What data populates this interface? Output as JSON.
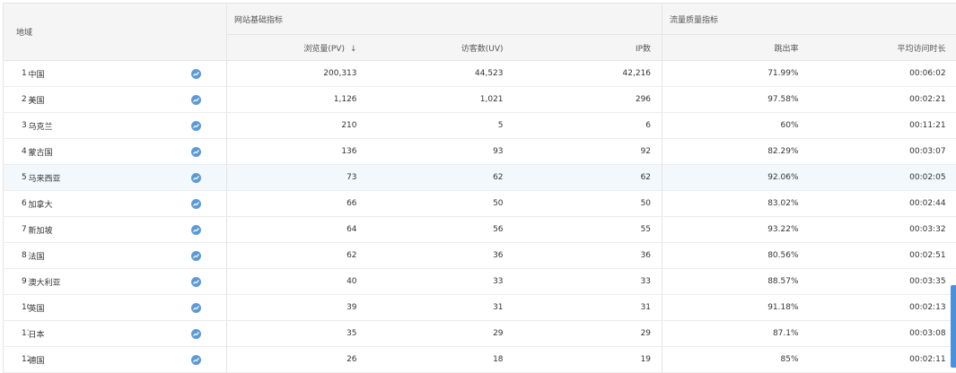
{
  "header": {
    "region": "地域",
    "group_basic": "网站基础指标",
    "group_quality": "流量质量指标",
    "cols": {
      "pv": "浏览量(PV)",
      "uv": "访客数(UV)",
      "ip": "IP数",
      "bounce": "跳出率",
      "avg_time": "平均访问时长"
    },
    "sort_indicator": "↓"
  },
  "rows": [
    {
      "rank": "1",
      "name": "中国",
      "pv": "200,313",
      "uv": "44,523",
      "ip": "42,216",
      "bounce": "71.99%",
      "avg_time": "00:06:02"
    },
    {
      "rank": "2",
      "name": "美国",
      "pv": "1,126",
      "uv": "1,021",
      "ip": "296",
      "bounce": "97.58%",
      "avg_time": "00:02:21"
    },
    {
      "rank": "3",
      "name": "乌克兰",
      "pv": "210",
      "uv": "5",
      "ip": "6",
      "bounce": "60%",
      "avg_time": "00:11:21"
    },
    {
      "rank": "4",
      "name": "蒙古国",
      "pv": "136",
      "uv": "93",
      "ip": "92",
      "bounce": "82.29%",
      "avg_time": "00:03:07"
    },
    {
      "rank": "5",
      "name": "马来西亚",
      "pv": "73",
      "uv": "62",
      "ip": "62",
      "bounce": "92.06%",
      "avg_time": "00:02:05"
    },
    {
      "rank": "6",
      "name": "加拿大",
      "pv": "66",
      "uv": "50",
      "ip": "50",
      "bounce": "83.02%",
      "avg_time": "00:02:44"
    },
    {
      "rank": "7",
      "name": "新加坡",
      "pv": "64",
      "uv": "56",
      "ip": "55",
      "bounce": "93.22%",
      "avg_time": "00:03:32"
    },
    {
      "rank": "8",
      "name": "法国",
      "pv": "62",
      "uv": "36",
      "ip": "36",
      "bounce": "80.56%",
      "avg_time": "00:02:51"
    },
    {
      "rank": "9",
      "name": "澳大利亚",
      "pv": "40",
      "uv": "33",
      "ip": "33",
      "bounce": "88.57%",
      "avg_time": "00:03:35"
    },
    {
      "rank": "10",
      "name": "英国",
      "pv": "39",
      "uv": "31",
      "ip": "31",
      "bounce": "91.18%",
      "avg_time": "00:02:13"
    },
    {
      "rank": "11",
      "name": "日本",
      "pv": "35",
      "uv": "29",
      "ip": "29",
      "bounce": "87.1%",
      "avg_time": "00:03:08"
    },
    {
      "rank": "12",
      "name": "德国",
      "pv": "26",
      "uv": "18",
      "ip": "19",
      "bounce": "85%",
      "avg_time": "00:02:11"
    }
  ],
  "icons": {
    "trend": "trend-chart-icon",
    "sort": "sort-down-icon"
  },
  "colors": {
    "trend_icon": "#5b9bd5",
    "header_bg": "#f5f5f5",
    "highlight_row": "#f3f8fd",
    "scroll_thumb": "#4a8fe0"
  }
}
